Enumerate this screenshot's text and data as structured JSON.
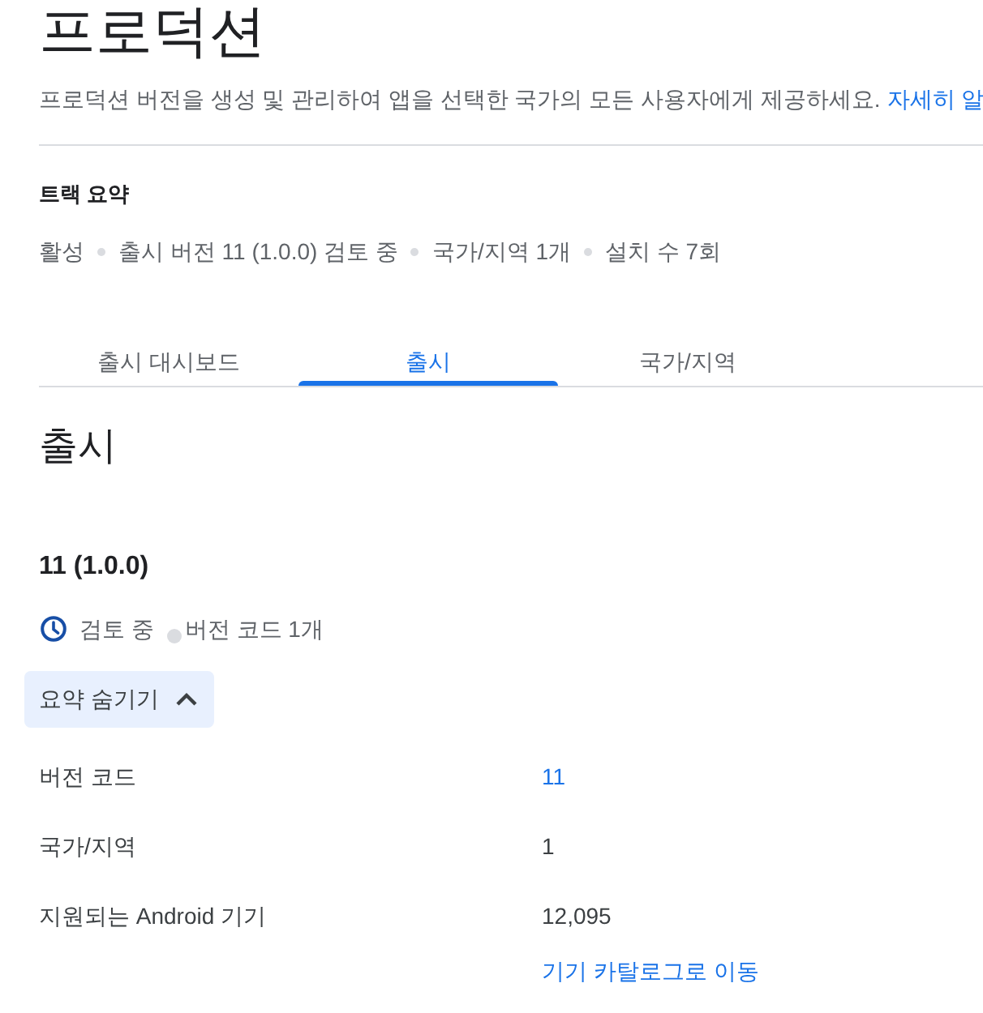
{
  "page": {
    "title": "프로덕션",
    "description": "프로덕션 버전을 생성 및 관리하여 앱을 선택한 국가의 모든 사용자에게 제공하세요.",
    "learn_more_link": "자세히 알"
  },
  "track_summary": {
    "heading": "트랙 요약",
    "items": [
      "활성",
      "출시 버전 11 (1.0.0) 검토 중",
      "국가/지역 1개",
      "설치 수 7회"
    ]
  },
  "tabs": [
    {
      "label": "출시 대시보드",
      "selected": false
    },
    {
      "label": "출시",
      "selected": true
    },
    {
      "label": "국가/지역",
      "selected": false
    }
  ],
  "release_section": {
    "heading": "출시",
    "release": {
      "version": "11 (1.0.0)",
      "status": "검토 중",
      "version_codes": "버전 코드 1개",
      "summary_toggle": {
        "label": "요약 숨기기",
        "expanded": true
      },
      "details": [
        {
          "label": "버전 코드",
          "kind": "link",
          "value": "11"
        },
        {
          "label": "국가/지역",
          "kind": "text",
          "value": "1"
        },
        {
          "label": "지원되는 Android 기기",
          "kind": "text",
          "value": "12,095",
          "link": "기기 카탈로그로 이동"
        }
      ]
    }
  }
}
